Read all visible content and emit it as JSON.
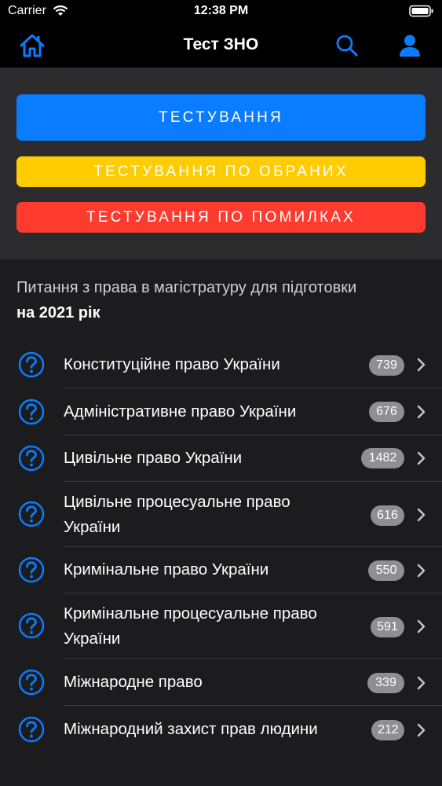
{
  "status_bar": {
    "carrier": "Carrier",
    "time": "12:38 PM"
  },
  "nav": {
    "title": "Тест ЗНО",
    "icons": [
      "home-icon",
      "search-icon",
      "user-icon"
    ]
  },
  "buttons": {
    "testing": "ТЕСТУВАННЯ",
    "favorites": "ТЕСТУВАННЯ ПО ОБРАНИХ",
    "mistakes": "ТЕСТУВАННЯ ПО ПОМИЛКАХ"
  },
  "section": {
    "title_regular": "Питання з права в магістратуру для підготовки",
    "title_bold": "на 2021 рік"
  },
  "categories": [
    {
      "label": "Конституційне право України",
      "count": "739"
    },
    {
      "label": "Адміністративне право України",
      "count": "676"
    },
    {
      "label": "Цивільне право України",
      "count": "1482"
    },
    {
      "label_line1": "Цивільне процесуальне право",
      "label_line2": "України",
      "count": "616"
    },
    {
      "label": "Кримінальне право України",
      "count": "550"
    },
    {
      "label_line1": "Кримінальне процесуальне право",
      "label_line2": "України",
      "count": "591"
    },
    {
      "label": "Міжнародне право",
      "count": "339"
    },
    {
      "label": "Міжнародний захист прав людини",
      "count": "212"
    }
  ],
  "colors": {
    "accent": "#0a7cff",
    "yellow": "#ffcc00",
    "red": "#ff3b30",
    "badge": "#8e8e93",
    "background": "#1c1c1e"
  }
}
